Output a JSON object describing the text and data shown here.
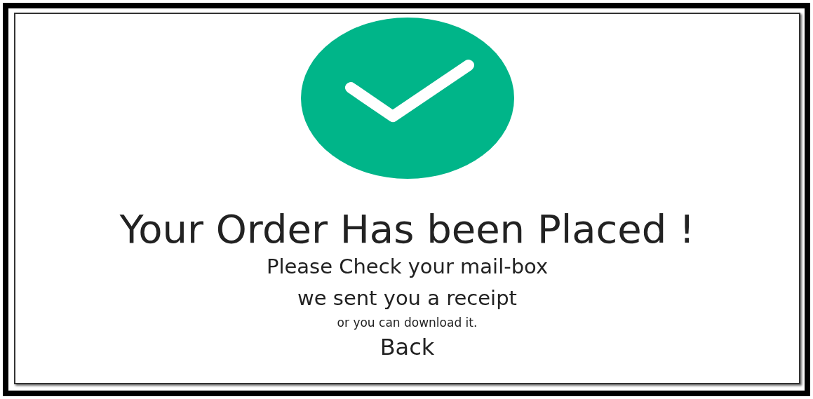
{
  "confirmation": {
    "title": "Your Order Has been Placed !",
    "lines": [
      "Please Check your mail-box",
      "we sent you a receipt"
    ],
    "note": "or you can download it.",
    "back_link": "Back"
  }
}
